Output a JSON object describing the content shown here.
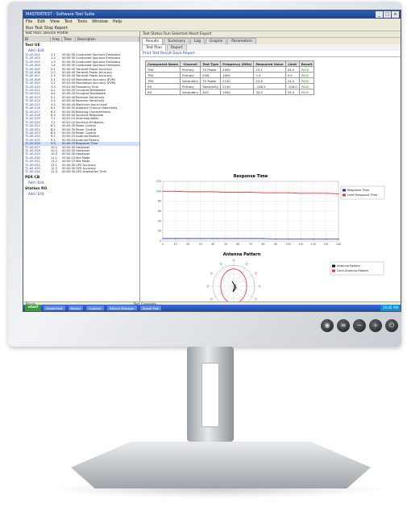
{
  "window": {
    "title": "MASTERTEST - Software Tool Suite",
    "controls": [
      "_",
      "□",
      "×"
    ]
  },
  "menu": [
    "File",
    "Edit",
    "View",
    "Test",
    "Tools",
    "Window",
    "Help"
  ],
  "toolbar_text": "Run Test   Stop   Report",
  "left_pane": {
    "header": "Test Plan: Device Profile",
    "columns": [
      "ID",
      "Freq",
      "Time",
      "Description"
    ],
    "group1": "Test UE",
    "group1_link": "Add / Edit",
    "rows": [
      {
        "id": "TC-UE-001",
        "c2": "1.1",
        "c3": "00:00:30",
        "desc": "Conducted Spurious Emissions"
      },
      {
        "id": "TC-UE-002",
        "c2": "1.2",
        "c3": "00:00:30",
        "desc": "Conducted Spurious Emissions"
      },
      {
        "id": "TC-UE-003",
        "c2": "1.3",
        "c3": "00:00:30",
        "desc": "Conducted Spurious Emissions"
      },
      {
        "id": "TC-UE-004",
        "c2": "1.4",
        "c3": "00:00:30",
        "desc": "Conducted Spurious Emissions"
      },
      {
        "id": "TC-UE-005",
        "c2": "2.1",
        "c3": "00:00:45",
        "desc": "Transmit Power Accuracy"
      },
      {
        "id": "TC-UE-006",
        "c2": "2.2",
        "c3": "00:00:45",
        "desc": "Transmit Power Accuracy"
      },
      {
        "id": "TC-UE-007",
        "c2": "2.3",
        "c3": "00:00:45",
        "desc": "Transmit Power Accuracy"
      },
      {
        "id": "TC-UE-008",
        "c2": "3.1",
        "c3": "00:01:00",
        "desc": "Modulation Accuracy (EVM)"
      },
      {
        "id": "TC-UE-009",
        "c2": "3.2",
        "c3": "00:01:00",
        "desc": "Modulation Accuracy (EVM)"
      },
      {
        "id": "TC-UE-010",
        "c2": "3.3",
        "c3": "00:01:00",
        "desc": "Frequency Error"
      },
      {
        "id": "TC-UE-011",
        "c2": "4.1",
        "c3": "00:00:20",
        "desc": "Occupied Bandwidth"
      },
      {
        "id": "TC-UE-012",
        "c2": "4.2",
        "c3": "00:00:20",
        "desc": "Occupied Bandwidth"
      },
      {
        "id": "TC-UE-013",
        "c2": "5.1",
        "c3": "00:00:40",
        "desc": "Receiver Sensitivity"
      },
      {
        "id": "TC-UE-014",
        "c2": "5.2",
        "c3": "00:00:40",
        "desc": "Receiver Sensitivity"
      },
      {
        "id": "TC-UE-015",
        "c2": "5.3",
        "c3": "00:00:40",
        "desc": "Maximum Input Level"
      },
      {
        "id": "TC-UE-016",
        "c2": "6.1",
        "c3": "00:00:50",
        "desc": "Adjacent Channel Selectivity"
      },
      {
        "id": "TC-UE-017",
        "c2": "6.2",
        "c3": "00:00:50",
        "desc": "Blocking Characteristics"
      },
      {
        "id": "TC-UE-018",
        "c2": "6.3",
        "c3": "00:00:50",
        "desc": "Spurious Response"
      },
      {
        "id": "TC-UE-019",
        "c2": "7.1",
        "c3": "00:01:10",
        "desc": "Intermodulation"
      },
      {
        "id": "TC-UE-020",
        "c2": "7.2",
        "c3": "00:01:10",
        "desc": "Spurious Emissions"
      },
      {
        "id": "TC-UE-021",
        "c2": "8.1",
        "c3": "00:00:35",
        "desc": "Power Control"
      },
      {
        "id": "TC-UE-022",
        "c2": "8.2",
        "c3": "00:00:35",
        "desc": "Power Control"
      },
      {
        "id": "TC-UE-023",
        "c2": "8.3",
        "c3": "00:00:35",
        "desc": "Power Control"
      },
      {
        "id": "TC-UE-024",
        "c2": "9.1",
        "c3": "00:00:25",
        "desc": "Antenna Pattern"
      },
      {
        "id": "TC-UE-025",
        "c2": "9.2",
        "c3": "00:00:25",
        "desc": "Antenna Pattern"
      },
      {
        "id": "TC-UE-026",
        "c2": "9.3",
        "c3": "00:00:25",
        "desc": "Response Time"
      },
      {
        "id": "TC-UE-027",
        "c2": "10.1",
        "c3": "00:00:30",
        "desc": "Handover"
      },
      {
        "id": "TC-UE-028",
        "c2": "10.2",
        "c3": "00:00:30",
        "desc": "Handover"
      },
      {
        "id": "TC-UE-029",
        "c2": "10.3",
        "c3": "00:00:30",
        "desc": "Handover"
      },
      {
        "id": "TC-UE-030",
        "c2": "11.1",
        "c3": "00:00:15",
        "desc": "Idle Mode"
      },
      {
        "id": "TC-UE-031",
        "c2": "11.2",
        "c3": "00:00:15",
        "desc": "Idle Mode"
      },
      {
        "id": "TC-UE-032",
        "c2": "12.1",
        "c3": "00:00:30",
        "desc": "GPS Accuracy"
      },
      {
        "id": "TC-UE-033",
        "c2": "12.2",
        "c3": "00:00:30",
        "desc": "GPS Accuracy"
      },
      {
        "id": "TC-UE-034",
        "c2": "12.3",
        "c3": "00:00:30",
        "desc": "GPS Acquisition Time"
      }
    ],
    "group2": "PER CB",
    "group2_link": "Add / Edit",
    "group3": "Station RO",
    "group3_link": "Add / Edit"
  },
  "right_pane": {
    "toolbar": "Test Status   Run Selected   Abort   Export",
    "tabs": [
      "Results",
      "Summary",
      "Log",
      "Graphs",
      "Parameters"
    ],
    "subtabs": [
      "Test Plan",
      "Report"
    ],
    "actions": "Print Test Result   Save Report",
    "table": {
      "headers": [
        "Component Name",
        "Channel",
        "Test Type",
        "Frequency (MHz)",
        "Measured Value",
        "Limit",
        "Result"
      ],
      "rows": [
        [
          "TRX",
          "Primary",
          "TX Power",
          "1950",
          "23.1",
          "24.0",
          "PASS"
        ],
        [
          "TRX",
          "Primary",
          "EVM",
          "1950",
          "2.4",
          "5.0",
          "PASS"
        ],
        [
          "TRX",
          "Secondary",
          "TX Power",
          "2140",
          "22.8",
          "24.0",
          "PASS"
        ],
        [
          "RX",
          "Primary",
          "Sensitivity",
          "2140",
          "-106.2",
          "-104.0",
          "PASS"
        ],
        [
          "RX",
          "Secondary",
          "ACS",
          "1950",
          "34.5",
          "33.0",
          "PASS"
        ]
      ]
    }
  },
  "chart_data": [
    {
      "type": "line",
      "title": "Response Time",
      "xlabel": "",
      "ylabel": "",
      "x": [
        0,
        10,
        20,
        30,
        40,
        50,
        60,
        70,
        80,
        90,
        100,
        110,
        120,
        130,
        140
      ],
      "xlim": [
        0,
        140
      ],
      "ylim": [
        0,
        120
      ],
      "series": [
        {
          "name": "Response Time",
          "color": "#1f2fd0",
          "values": [
            5,
            5,
            5,
            5,
            5,
            5,
            5,
            5,
            5,
            4,
            4,
            4,
            4,
            4,
            4
          ]
        },
        {
          "name": "Limit Response Time",
          "color": "#e53935",
          "values": [
            100,
            100,
            99,
            99,
            99,
            98,
            98,
            98,
            97,
            97,
            97,
            96,
            96,
            96,
            95
          ]
        }
      ],
      "grid": true,
      "legend": "right"
    },
    {
      "type": "polar",
      "title": "Antenna Pattern",
      "series": [
        {
          "name": "Antenna Pattern",
          "color": "#111111"
        },
        {
          "name": "Limit Antenna Pattern",
          "color": "#e53935"
        }
      ],
      "legend": "right"
    }
  ],
  "status": {
    "left": "Ready",
    "right": "Test Complete"
  },
  "taskbar": {
    "start": "start",
    "items": [
      "Mastertest",
      "Report",
      "Explorer",
      "Device Manager",
      "Signal Gen"
    ],
    "clock": "10:42 AM"
  },
  "monitor_buttons": [
    "◉",
    "≡",
    "−",
    "+",
    "⏻"
  ]
}
